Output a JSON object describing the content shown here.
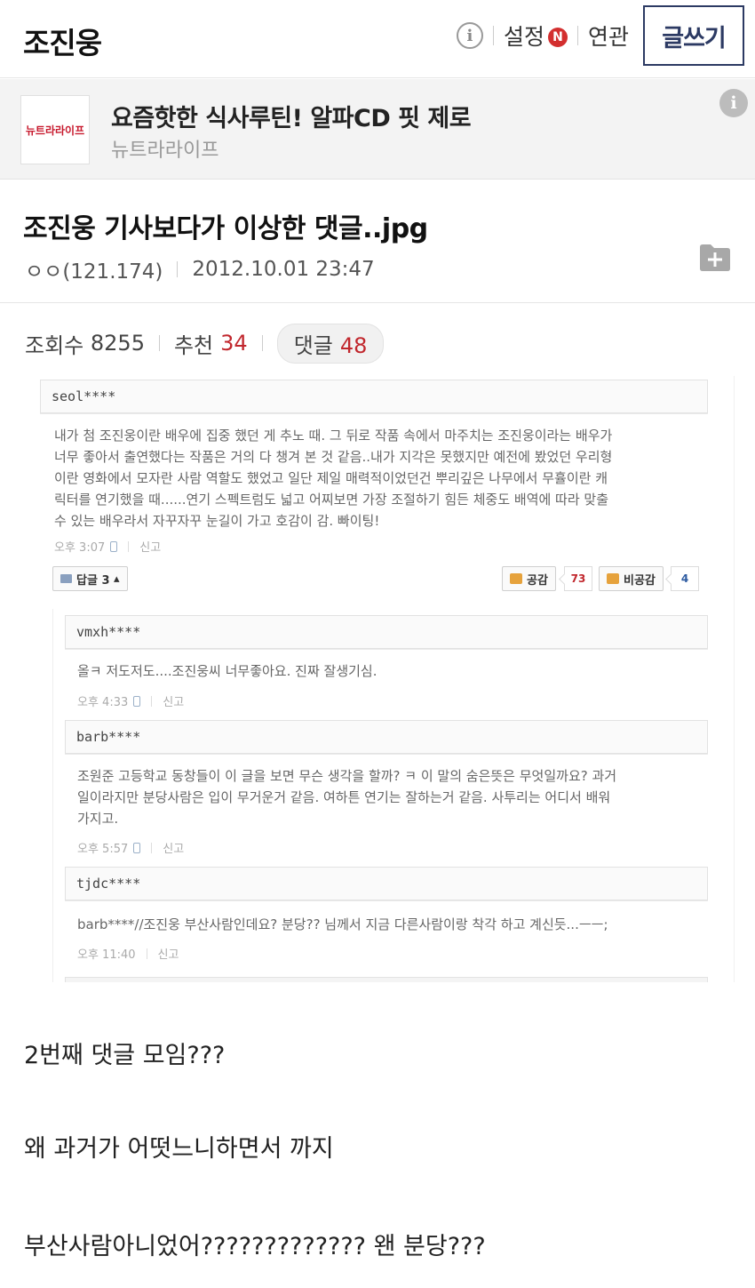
{
  "header": {
    "gallery_name": "조진웅",
    "settings_label": "설정",
    "new_badge": "N",
    "related_label": "연관",
    "write_label": "글쓰기"
  },
  "ad": {
    "logo_text": "뉴트라라이프",
    "title": "요즘핫한 식사루틴! 알파CD 핏 제로",
    "brand": "뉴트라라이프"
  },
  "post": {
    "title": "조진웅 기사보다가 이상한 댓글..jpg",
    "author": "ㅇㅇ(121.174)",
    "date": "2012.10.01 23:47",
    "views_label": "조회수",
    "views": "8255",
    "recommend_label": "추천",
    "recommend": "34",
    "comments_label": "댓글",
    "comments": "48"
  },
  "screenshot": {
    "main_comment": {
      "user": "seol****",
      "lines": [
        "내가 첨 조진웅이란 배우에 집중 했던 게 추노 때. 그 뒤로 작품 속에서 마주치는 조진웅이라는 배우가",
        "너무 좋아서 출연했다는 작품은 거의 다 챙겨 본 것 같음..내가 지각은 못했지만 예전에 봤었던 우리형",
        "이란 영화에서 모자란 사람 역할도 했었고 일단 제일 매력적이었던건 뿌리깊은 나무에서 무휼이란 캐",
        "릭터를 연기했을 때......연기 스펙트럼도 넓고 어찌보면 가장 조절하기 힘든 체중도 배역에 따라 맞출",
        "수 있는 배우라서 자꾸자꾸 눈길이 가고 호감이 감. 빠이팅!"
      ],
      "time": "오후 3:07",
      "report": "신고",
      "reply_label": "답글 3",
      "like_label": "공감",
      "like_count": "73",
      "dislike_label": "비공감",
      "dislike_count": "4"
    },
    "replies": [
      {
        "user": "vmxh****",
        "lines": [
          "올ㅋ 저도저도....조진웅씨 너무좋아요. 진짜 잘생기심."
        ],
        "time": "오후 4:33",
        "report": "신고"
      },
      {
        "user": "barb****",
        "lines": [
          "조원준 고등학교 동창들이 이 글을 보면 무슨 생각을 할까? ㅋ 이 말의 숨은뜻은 무엇일까요? 과거",
          "일이라지만 분당사람은 입이 무거운거 같음. 여하튼 연기는 잘하는거 같음. 사투리는 어디서 배워",
          "가지고."
        ],
        "time": "오후 5:57",
        "report": "신고"
      },
      {
        "user": "tjdc****",
        "lines": [
          "barb****//조진웅 부산사람인데요? 분당?? 님께서 지금 다른사람이랑 착각 하고 계신듯...ㅡㅡ;"
        ],
        "time": "오후 11:40",
        "report": "신고"
      }
    ]
  },
  "body": [
    "2번째 댓글 모임???",
    "왜 과거가 어떳느니하면서 까지",
    "부산사람아니었어????????????? 왠 분당???"
  ],
  "colors": {
    "accent_red": "#c1272d",
    "write_button": "#2c3a63"
  }
}
